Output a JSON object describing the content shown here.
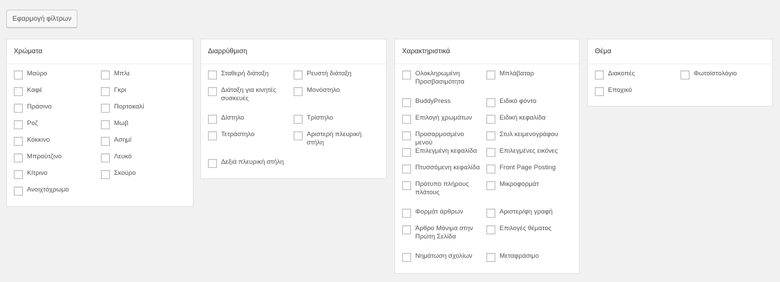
{
  "apply_button": "Εφαρμογή φίλτρων",
  "panels": [
    {
      "title": "Χρώματα",
      "col1": [
        "Μαύρο",
        "Καφέ",
        "Πράσινο",
        "Ροζ",
        "Κόκκινο",
        "Μπρούτζινο",
        "Κίτρινο",
        "Ανοιχτόχρωμο"
      ],
      "col2": [
        "Μπλε",
        "Γκρι",
        "Πορτοκαλί",
        "Μωβ",
        "Ασημί",
        "Λευκό",
        "Σκούρο"
      ]
    },
    {
      "title": "Διαρρύθμιση",
      "col1": [
        "Σταθερή διάταξη",
        "Διάταξη για κινητές συσκευές",
        "Δίστηλο",
        "Τετράστηλο",
        "Δεξιά πλευρική στήλη"
      ],
      "col2": [
        "Ρευστή διάταξη",
        "Μονόστηλο",
        "Τρίστηλο",
        "Αριστερή πλευρική στήλη"
      ]
    },
    {
      "title": "Χαρακτηριστικά",
      "col1": [
        "Ολοκληρωμένη Προσβασιμότητα",
        "BuddyPress",
        "Επιλογή χρωμάτων",
        "Προσαρμοσμένο μενού",
        "Επιλεγμένη κεφαλίδα",
        "Πτυσσόμενη κεφαλίδα",
        "Πρότυπο πλήρους πλάτους",
        "Φορμάτ άρθρων",
        "Άρθρο Μόνιμα στην Πρώτη Σελίδα",
        "Νημάτωση σχολίων"
      ],
      "col2": [
        "Μπλάβαταρ",
        "Ειδικό φόντο",
        "Ειδική κεφαλίδα",
        "Στυλ κειμενογράφου",
        "Επιλεγμένες εικόνες",
        "Front Page Posting",
        "Μικροφορμάτ",
        "Αριστερ/φη γραφή",
        "Επιλογές θέματος",
        "Μεταφράσιμο"
      ]
    },
    {
      "title": "Θέμα",
      "col1": [
        "Διακοπές",
        "Εποχικό"
      ],
      "col2": [
        "Φωτοϊστολόγιο"
      ]
    }
  ]
}
